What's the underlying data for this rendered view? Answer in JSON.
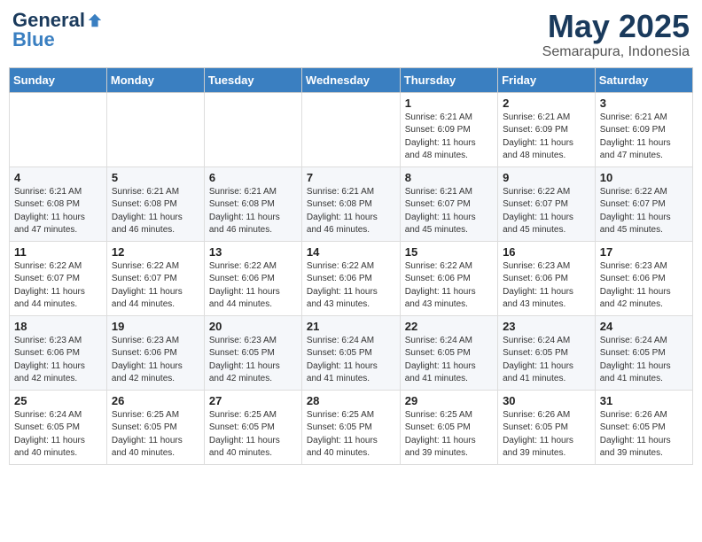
{
  "header": {
    "logo_general": "General",
    "logo_blue": "Blue",
    "title": "May 2025",
    "subtitle": "Semarapura, Indonesia"
  },
  "days_of_week": [
    "Sunday",
    "Monday",
    "Tuesday",
    "Wednesday",
    "Thursday",
    "Friday",
    "Saturday"
  ],
  "weeks": [
    [
      {
        "day": "",
        "info": ""
      },
      {
        "day": "",
        "info": ""
      },
      {
        "day": "",
        "info": ""
      },
      {
        "day": "",
        "info": ""
      },
      {
        "day": "1",
        "info": "Sunrise: 6:21 AM\nSunset: 6:09 PM\nDaylight: 11 hours\nand 48 minutes."
      },
      {
        "day": "2",
        "info": "Sunrise: 6:21 AM\nSunset: 6:09 PM\nDaylight: 11 hours\nand 48 minutes."
      },
      {
        "day": "3",
        "info": "Sunrise: 6:21 AM\nSunset: 6:09 PM\nDaylight: 11 hours\nand 47 minutes."
      }
    ],
    [
      {
        "day": "4",
        "info": "Sunrise: 6:21 AM\nSunset: 6:08 PM\nDaylight: 11 hours\nand 47 minutes."
      },
      {
        "day": "5",
        "info": "Sunrise: 6:21 AM\nSunset: 6:08 PM\nDaylight: 11 hours\nand 46 minutes."
      },
      {
        "day": "6",
        "info": "Sunrise: 6:21 AM\nSunset: 6:08 PM\nDaylight: 11 hours\nand 46 minutes."
      },
      {
        "day": "7",
        "info": "Sunrise: 6:21 AM\nSunset: 6:08 PM\nDaylight: 11 hours\nand 46 minutes."
      },
      {
        "day": "8",
        "info": "Sunrise: 6:21 AM\nSunset: 6:07 PM\nDaylight: 11 hours\nand 45 minutes."
      },
      {
        "day": "9",
        "info": "Sunrise: 6:22 AM\nSunset: 6:07 PM\nDaylight: 11 hours\nand 45 minutes."
      },
      {
        "day": "10",
        "info": "Sunrise: 6:22 AM\nSunset: 6:07 PM\nDaylight: 11 hours\nand 45 minutes."
      }
    ],
    [
      {
        "day": "11",
        "info": "Sunrise: 6:22 AM\nSunset: 6:07 PM\nDaylight: 11 hours\nand 44 minutes."
      },
      {
        "day": "12",
        "info": "Sunrise: 6:22 AM\nSunset: 6:07 PM\nDaylight: 11 hours\nand 44 minutes."
      },
      {
        "day": "13",
        "info": "Sunrise: 6:22 AM\nSunset: 6:06 PM\nDaylight: 11 hours\nand 44 minutes."
      },
      {
        "day": "14",
        "info": "Sunrise: 6:22 AM\nSunset: 6:06 PM\nDaylight: 11 hours\nand 43 minutes."
      },
      {
        "day": "15",
        "info": "Sunrise: 6:22 AM\nSunset: 6:06 PM\nDaylight: 11 hours\nand 43 minutes."
      },
      {
        "day": "16",
        "info": "Sunrise: 6:23 AM\nSunset: 6:06 PM\nDaylight: 11 hours\nand 43 minutes."
      },
      {
        "day": "17",
        "info": "Sunrise: 6:23 AM\nSunset: 6:06 PM\nDaylight: 11 hours\nand 42 minutes."
      }
    ],
    [
      {
        "day": "18",
        "info": "Sunrise: 6:23 AM\nSunset: 6:06 PM\nDaylight: 11 hours\nand 42 minutes."
      },
      {
        "day": "19",
        "info": "Sunrise: 6:23 AM\nSunset: 6:06 PM\nDaylight: 11 hours\nand 42 minutes."
      },
      {
        "day": "20",
        "info": "Sunrise: 6:23 AM\nSunset: 6:05 PM\nDaylight: 11 hours\nand 42 minutes."
      },
      {
        "day": "21",
        "info": "Sunrise: 6:24 AM\nSunset: 6:05 PM\nDaylight: 11 hours\nand 41 minutes."
      },
      {
        "day": "22",
        "info": "Sunrise: 6:24 AM\nSunset: 6:05 PM\nDaylight: 11 hours\nand 41 minutes."
      },
      {
        "day": "23",
        "info": "Sunrise: 6:24 AM\nSunset: 6:05 PM\nDaylight: 11 hours\nand 41 minutes."
      },
      {
        "day": "24",
        "info": "Sunrise: 6:24 AM\nSunset: 6:05 PM\nDaylight: 11 hours\nand 41 minutes."
      }
    ],
    [
      {
        "day": "25",
        "info": "Sunrise: 6:24 AM\nSunset: 6:05 PM\nDaylight: 11 hours\nand 40 minutes."
      },
      {
        "day": "26",
        "info": "Sunrise: 6:25 AM\nSunset: 6:05 PM\nDaylight: 11 hours\nand 40 minutes."
      },
      {
        "day": "27",
        "info": "Sunrise: 6:25 AM\nSunset: 6:05 PM\nDaylight: 11 hours\nand 40 minutes."
      },
      {
        "day": "28",
        "info": "Sunrise: 6:25 AM\nSunset: 6:05 PM\nDaylight: 11 hours\nand 40 minutes."
      },
      {
        "day": "29",
        "info": "Sunrise: 6:25 AM\nSunset: 6:05 PM\nDaylight: 11 hours\nand 39 minutes."
      },
      {
        "day": "30",
        "info": "Sunrise: 6:26 AM\nSunset: 6:05 PM\nDaylight: 11 hours\nand 39 minutes."
      },
      {
        "day": "31",
        "info": "Sunrise: 6:26 AM\nSunset: 6:05 PM\nDaylight: 11 hours\nand 39 minutes."
      }
    ]
  ]
}
